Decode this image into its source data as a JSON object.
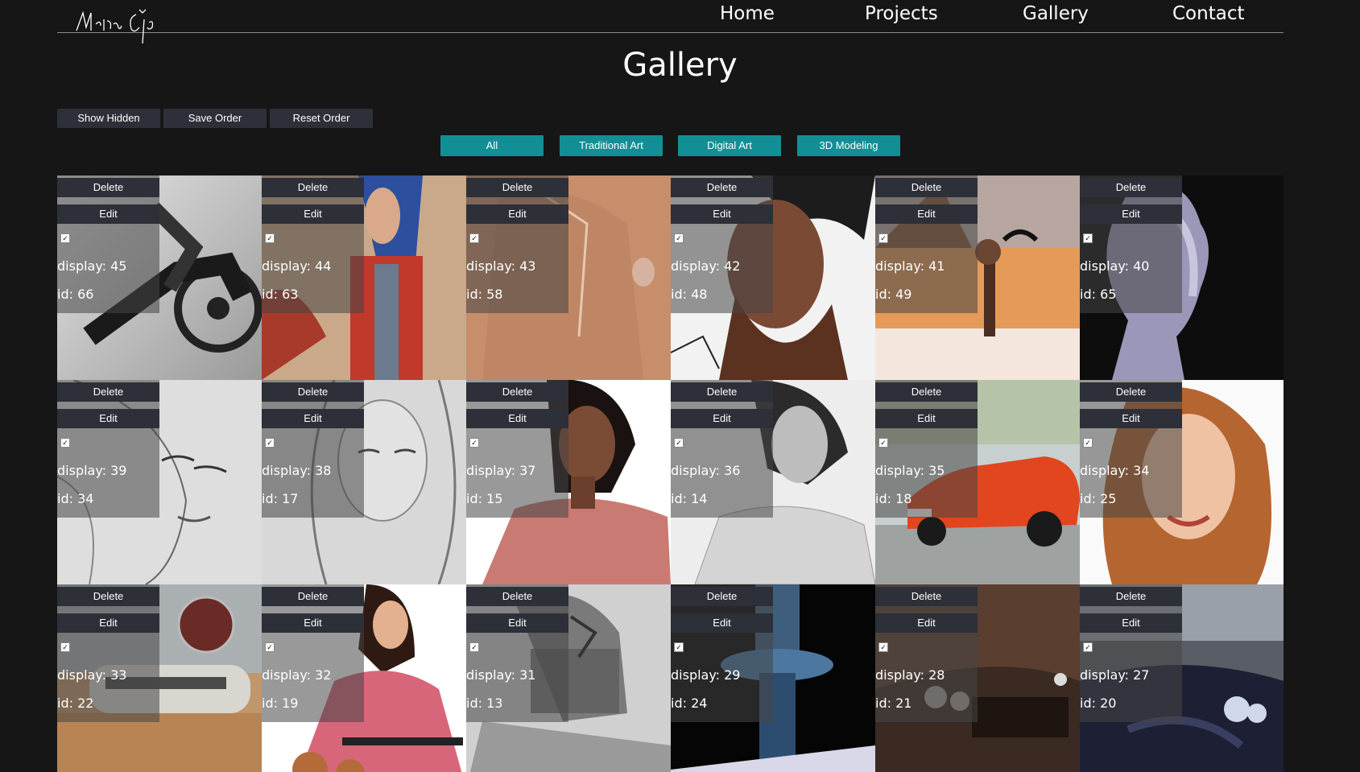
{
  "nav": {
    "logo_text": "Martin Čelp",
    "links": [
      "Home",
      "Projects",
      "Gallery",
      "Contact"
    ]
  },
  "page": {
    "title": "Gallery"
  },
  "admin": {
    "buttons": [
      "Show Hidden",
      "Save Order",
      "Reset Order"
    ]
  },
  "filters": {
    "buttons": [
      "All",
      "Traditional Art",
      "Digital Art",
      "3D Modeling"
    ],
    "color": "#128f94"
  },
  "tile_labels": {
    "delete": "Delete",
    "edit": "Edit"
  },
  "items": [
    {
      "display": "display: 45",
      "id": "id: 66",
      "art": "charcoal-motorcycle"
    },
    {
      "display": "display: 44",
      "id": "id: 63",
      "art": "blue-hair-portrait"
    },
    {
      "display": "display: 43",
      "id": "id: 58",
      "art": "sepia-sketch"
    },
    {
      "display": "display: 42",
      "id": "id: 48",
      "art": "painted-face"
    },
    {
      "display": "display: 41",
      "id": "id: 49",
      "art": "desert-warrior"
    },
    {
      "display": "display: 40",
      "id": "id: 65",
      "art": "3d-bust"
    },
    {
      "display": "display: 39",
      "id": "id: 34",
      "art": "pencil-girl"
    },
    {
      "display": "display: 38",
      "id": "id: 17",
      "art": "pencil-woman"
    },
    {
      "display": "display: 37",
      "id": "id: 15",
      "art": "painted-woman"
    },
    {
      "display": "display: 36",
      "id": "id: 14",
      "art": "pencil-woman-2"
    },
    {
      "display": "display: 35",
      "id": "id: 18",
      "art": "orange-car"
    },
    {
      "display": "display: 34",
      "id": "id: 25",
      "art": "smiling-woman"
    },
    {
      "display": "display: 33",
      "id": "id: 22",
      "art": "desert-vehicle"
    },
    {
      "display": "display: 32",
      "id": "id: 19",
      "art": "pink-dress"
    },
    {
      "display": "display: 31",
      "id": "id: 13",
      "art": "warrior-sketch"
    },
    {
      "display": "display: 29",
      "id": "id: 24",
      "art": "control-tower"
    },
    {
      "display": "display: 28",
      "id": "id: 21",
      "art": "car-grille"
    },
    {
      "display": "display: 27",
      "id": "id: 20",
      "art": "dark-car"
    }
  ]
}
